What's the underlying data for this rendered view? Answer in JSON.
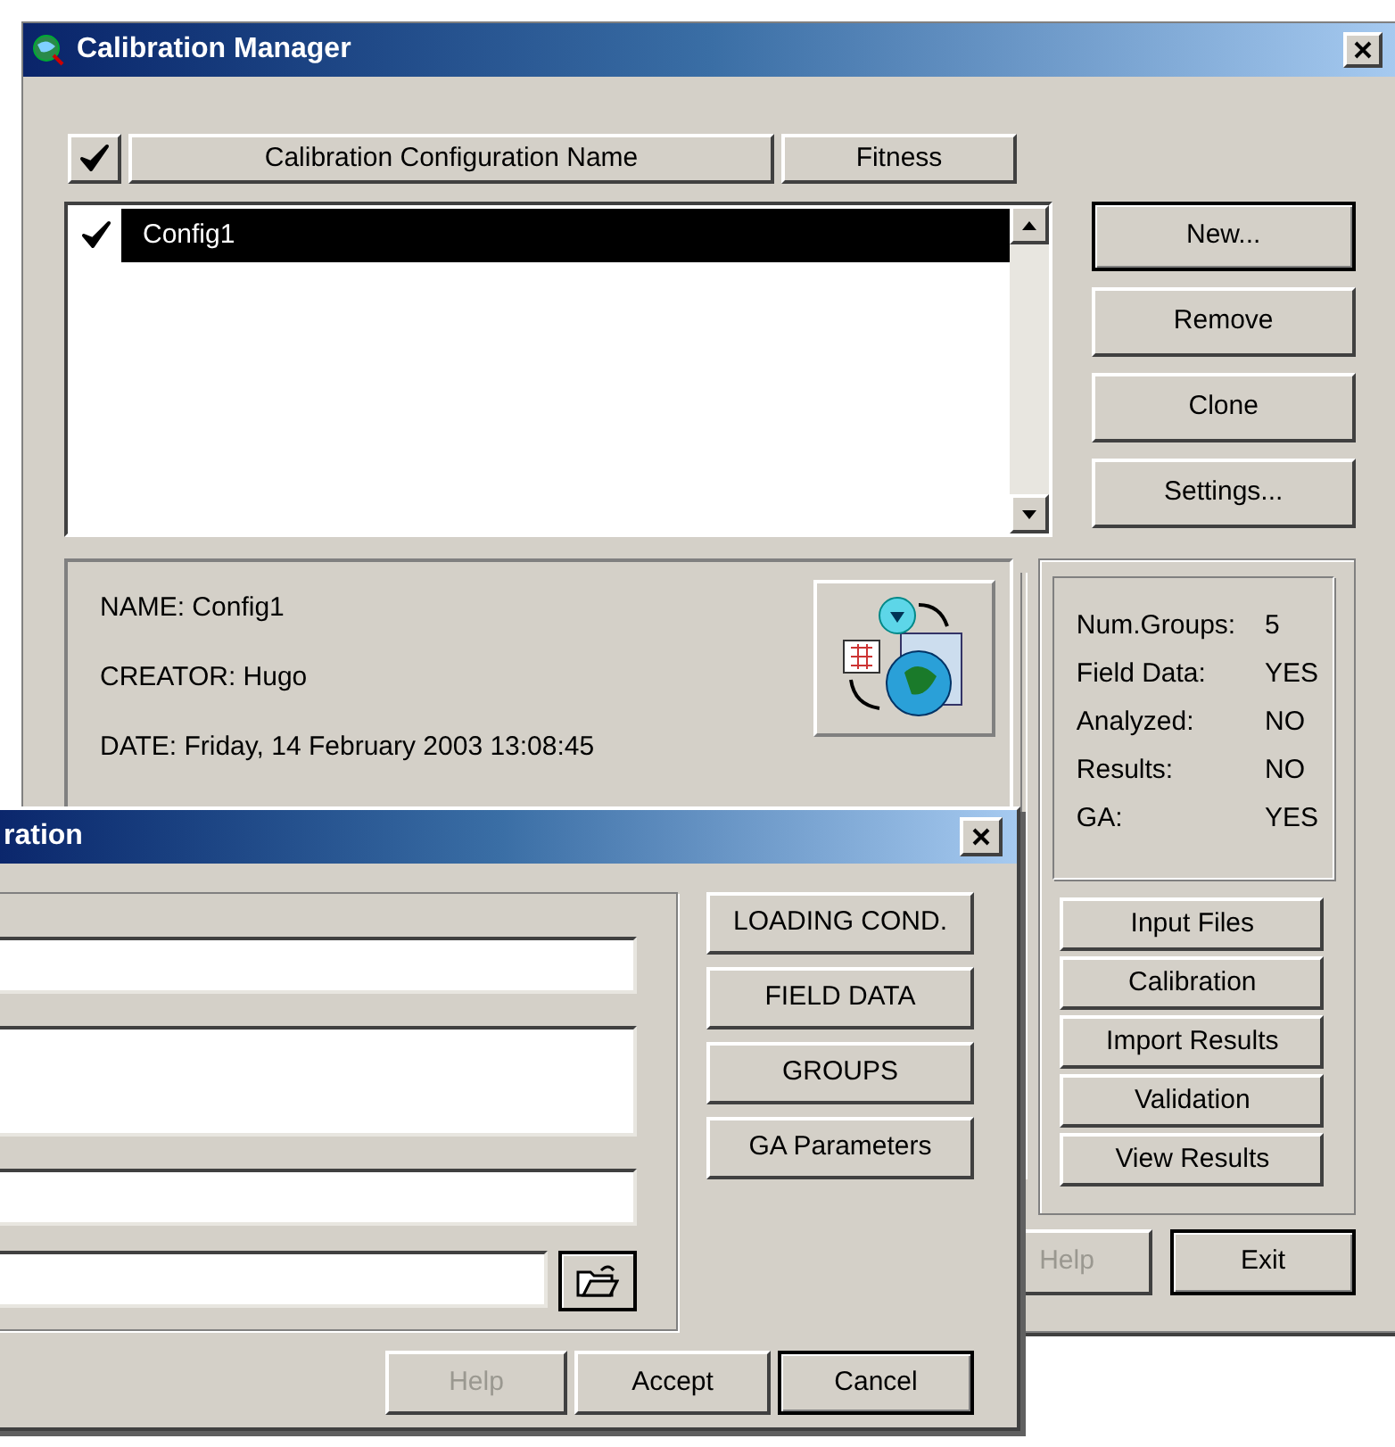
{
  "main_window": {
    "title": "Calibration Manager",
    "columns": [
      {
        "kind": "check",
        "checked": true
      },
      {
        "kind": "text",
        "label": "Calibration Configuration Name"
      },
      {
        "kind": "text",
        "label": "Fitness"
      }
    ],
    "configurations": [
      {
        "name": "Config1",
        "checked": true,
        "selected": true
      }
    ],
    "side_buttons": [
      {
        "label": "New...",
        "default": true
      },
      {
        "label": "Remove",
        "default": false
      },
      {
        "label": "Clone",
        "default": false
      },
      {
        "label": "Settings...",
        "default": false
      }
    ],
    "details": [
      "NAME: Config1",
      "CREATOR: Hugo",
      "DATE: Friday, 14 February 2003 13:08:45"
    ],
    "stats": [
      {
        "label": "Num.Groups:",
        "value": "5"
      },
      {
        "label": "Field Data:",
        "value": "YES"
      },
      {
        "label": "Analyzed:",
        "value": "NO"
      },
      {
        "label": "Results:",
        "value": "NO"
      },
      {
        "label": "GA:",
        "value": "YES"
      }
    ],
    "action_buttons": [
      "Input Files",
      "Calibration",
      "Import Results",
      "Validation",
      "View Results"
    ],
    "footer_buttons": [
      {
        "label": "Help",
        "disabled": true,
        "default": false
      },
      {
        "label": "Exit",
        "disabled": false,
        "default": true
      }
    ]
  },
  "dialog": {
    "title": "ration",
    "fields": [
      {
        "kind": "line"
      },
      {
        "kind": "area"
      },
      {
        "kind": "line"
      },
      {
        "kind": "file"
      }
    ],
    "side_buttons": [
      "LOADING COND.",
      "FIELD DATA",
      "GROUPS",
      "GA Parameters"
    ],
    "footer_buttons": [
      {
        "label": "Help",
        "disabled": true,
        "default": false
      },
      {
        "label": "Accept",
        "disabled": false,
        "default": false
      },
      {
        "label": "Cancel",
        "disabled": false,
        "default": true
      }
    ]
  }
}
